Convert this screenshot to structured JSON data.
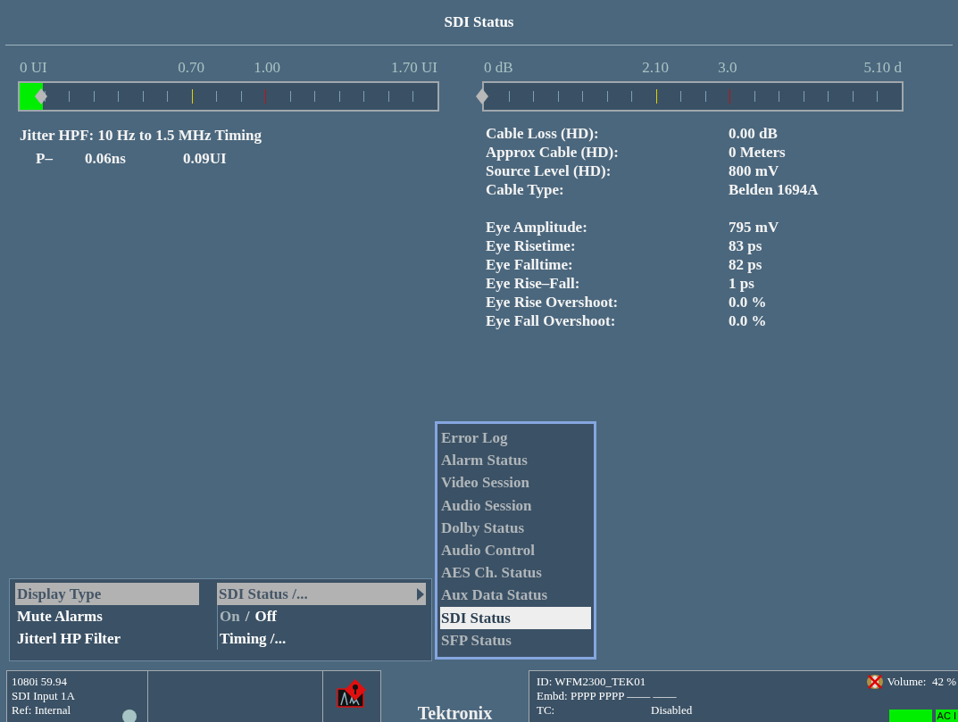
{
  "window": {
    "title": "SDI Status"
  },
  "meters": [
    {
      "scale": [
        "0 UI",
        "0.70",
        "1.00",
        "1.70 UI"
      ],
      "level": 0.055
    },
    {
      "scale": [
        "0 dB",
        "2.10",
        "3.0",
        "5.10 d"
      ],
      "level": 0
    }
  ],
  "jitter": {
    "title": "Jitter HPF: 10 Hz to 1.5 MHz Timing",
    "row": [
      "P–",
      "0.06ns",
      "0.09UI"
    ]
  },
  "cable": [
    {
      "label": "Cable Loss (HD):",
      "value": "0.00 dB"
    },
    {
      "label": "Approx Cable (HD):",
      "value": "0 Meters"
    },
    {
      "label": "Source Level (HD):",
      "value": "800 mV"
    },
    {
      "label": "Cable Type:",
      "value": "Belden 1694A"
    }
  ],
  "eye": [
    {
      "label": "Eye Amplitude:",
      "value": "795 mV"
    },
    {
      "label": "Eye Risetime:",
      "value": "83 ps"
    },
    {
      "label": "Eye Falltime:",
      "value": "82 ps"
    },
    {
      "label": "Eye Rise–Fall:",
      "value": "1 ps"
    },
    {
      "label": "Eye Rise Overshoot:",
      "value": "0.0 %"
    },
    {
      "label": "Eye Fall Overshoot:",
      "value": "0.0 %"
    }
  ],
  "menu": [
    {
      "kind": "submenu",
      "label": "Display Type",
      "value": "SDI Status /...",
      "selected": true
    },
    {
      "kind": "toggle",
      "label": "Mute Alarms",
      "options": [
        {
          "label": "On",
          "selected": false
        },
        {
          "label": "Off",
          "selected": true
        }
      ],
      "separator": "/",
      "selected": false
    },
    {
      "kind": "submenu",
      "label": "Jitterl HP Filter",
      "value": "Timing /...",
      "selected": false
    }
  ],
  "popup": [
    {
      "label": "Error Log",
      "selected": false
    },
    {
      "label": "Alarm Status",
      "selected": false
    },
    {
      "label": "Video Session",
      "selected": false
    },
    {
      "label": "Audio Session",
      "selected": false
    },
    {
      "label": "Dolby Status",
      "selected": false
    },
    {
      "label": "Audio Control",
      "selected": false
    },
    {
      "label": "AES Ch. Status",
      "selected": false
    },
    {
      "label": "Aux Data Status",
      "selected": false
    },
    {
      "label": "SDI Status",
      "selected": true
    },
    {
      "label": "SFP Status",
      "selected": false
    }
  ],
  "status_bar": {
    "input": [
      "1080i 59.94",
      "SDI Input 1A",
      "Ref: Internal"
    ],
    "logo": "Tektronix",
    "id": "ID: WFM2300_TEK01",
    "embd": "Embd: PPPP PPPP –––– ––––",
    "tc_label": "TC:",
    "tc_value": "Disabled",
    "volume": "Volume:  42 %",
    "power": "AC I"
  }
}
